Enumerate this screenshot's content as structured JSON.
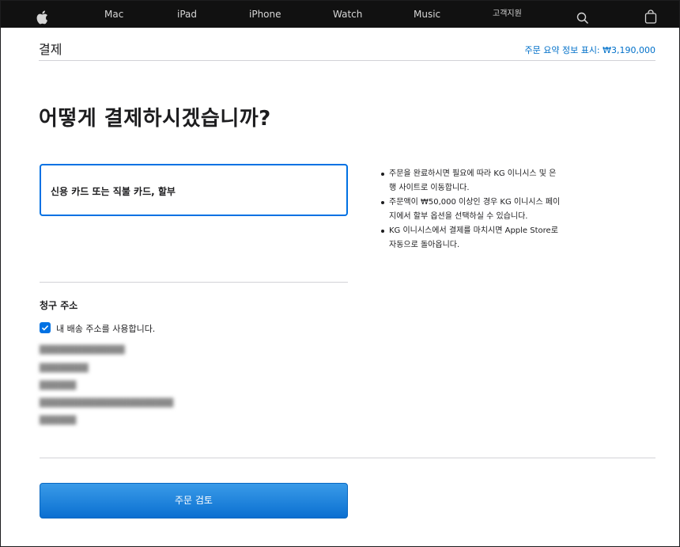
{
  "nav": {
    "items": [
      "Mac",
      "iPad",
      "iPhone",
      "Watch",
      "Music",
      "고객지원"
    ],
    "icons": [
      "apple-logo",
      "search-icon",
      "bag-icon"
    ]
  },
  "header": {
    "title": "결제",
    "summary_link": "주문 요약 정보 표시: ₩3,190,000"
  },
  "main": {
    "headline": "어떻게 결제하시겠습니까?",
    "payment_option": "신용 카드 또는 직불 카드, 할부",
    "info": [
      "주문을 완료하시면 필요에 따라 KG 이니시스 및 은행 사이트로 이동합니다.",
      "주문액이 ₩50,000 이상인 경우 KG 이니시스 페이지에서 할부 옵션을 선택하실 수 있습니다.",
      "KG 이니시스에서 결제를 마치시면 Apple Store로 자동으로 돌아옵니다."
    ]
  },
  "billing": {
    "title": "청구 주소",
    "use_shipping_label": "내 배송 주소를 사용합니다.",
    "use_shipping_checked": true
  },
  "actions": {
    "review_label": "주문 검토"
  },
  "colors": {
    "accent": "#0071e3",
    "link": "#0070c9",
    "nav_bg": "#111111"
  }
}
